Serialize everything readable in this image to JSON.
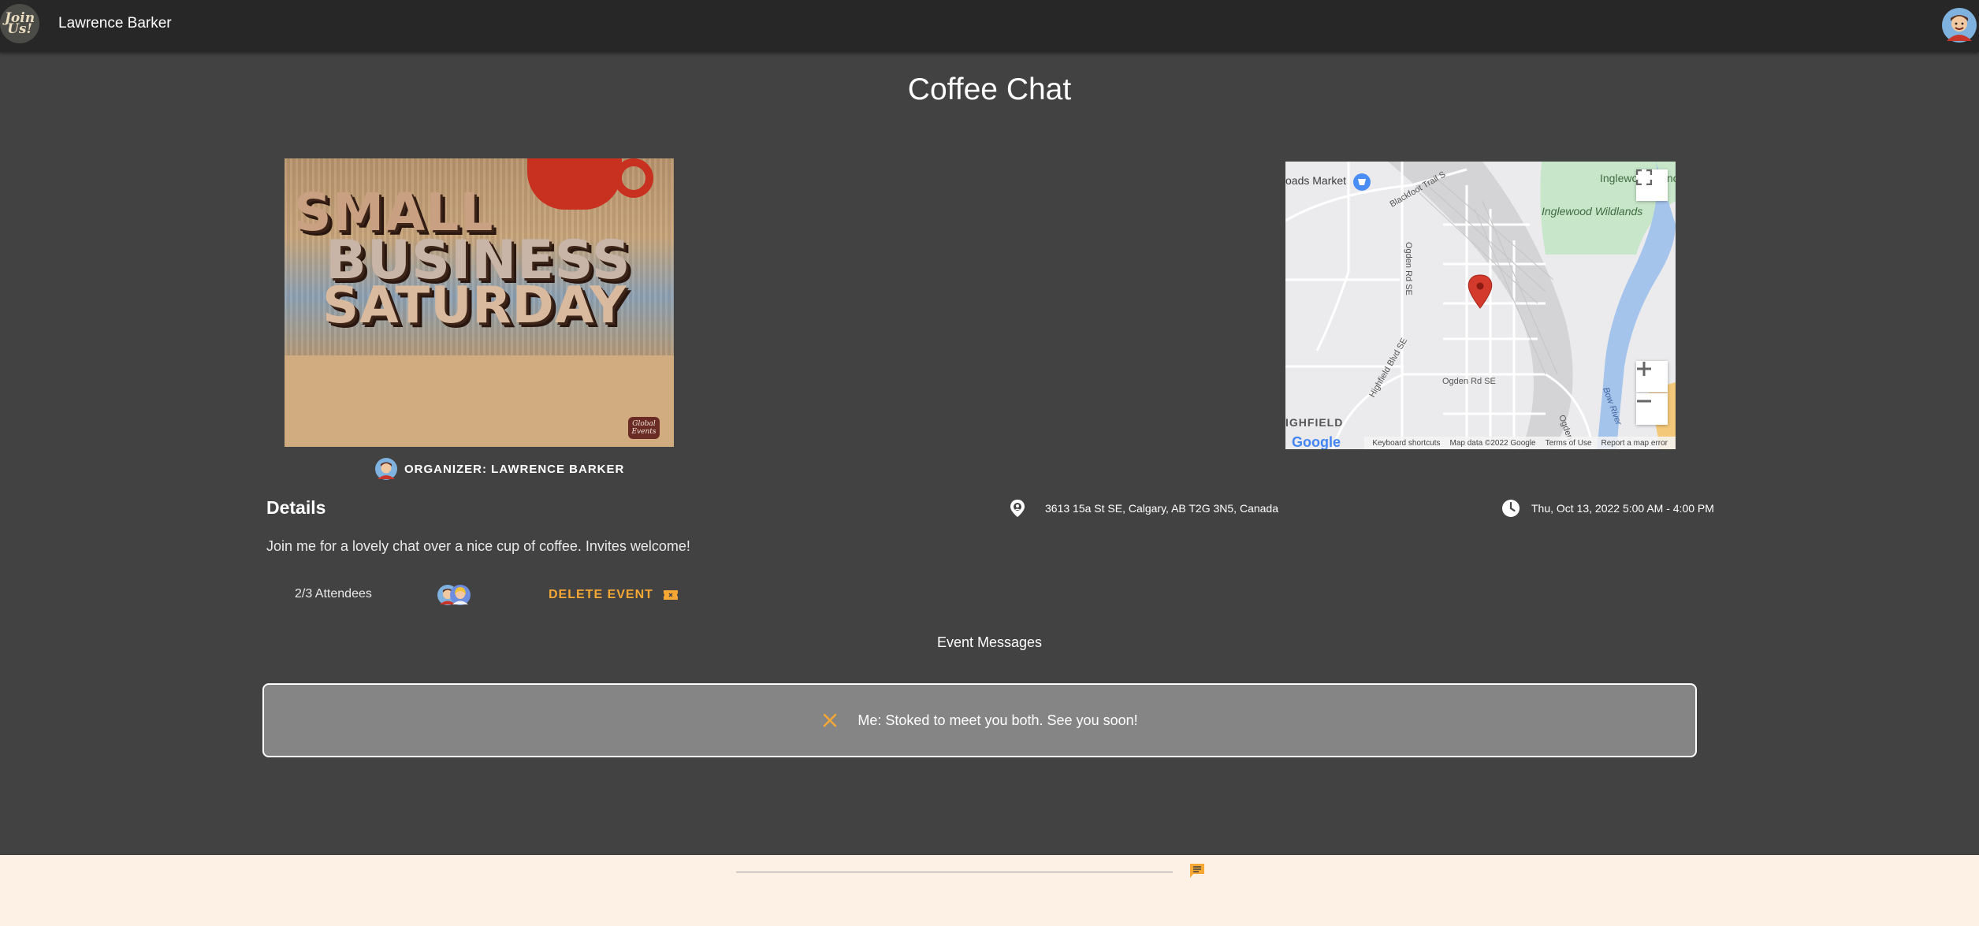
{
  "appbar": {
    "logo_text": "Join Us!",
    "title": "Lawrence Barker",
    "profile_icon": "user-avatar-icon"
  },
  "event": {
    "title": "Coffee Chat",
    "image": {
      "line1": "SMALL",
      "line2": "BUSINESS",
      "line3": "SATURDAY",
      "stamp": "Global Events"
    },
    "organizer_label": "ORGANIZER: LAWRENCE BARKER",
    "details_heading": "Details",
    "description": "Join me for a lovely chat over a nice cup of coffee. Invites welcome!",
    "location": "3613 15a St SE, Calgary, AB T2G 3N5, Canada",
    "datetime": "Thu, Oct 13, 2022 5:00 AM - 4:00 PM",
    "attendees": "2/3 Attendees",
    "delete_label": "DELETE EVENT"
  },
  "map": {
    "labels": {
      "market": "oads Market",
      "sanctuary": "Inglewood Sanctuary &",
      "wildlands": "Inglewood Wildlands",
      "blackfoot": "Blackfoot Trail S",
      "ogden_vertical": "Ogden Rd SE",
      "highfield_blvd": "Highfield Blvd SE",
      "ogden_horizontal": "Ogden Rd SE",
      "highfield": "IGHFIELD",
      "ogden_corner": "Ogden",
      "bow_river": "Bow River"
    },
    "footer": {
      "google": "Google",
      "shortcuts": "Keyboard shortcuts",
      "data": "Map data ©2022 Google",
      "terms": "Terms of Use",
      "report": "Report a map error"
    }
  },
  "messages": {
    "heading": "Event Messages",
    "items": [
      {
        "text": "Me: Stoked to meet you both. See you soon!"
      }
    ],
    "input_placeholder": ""
  },
  "colors": {
    "appbar": "#272727",
    "background": "#424242",
    "accent": "#f7a834",
    "footer": "#fcf1e4",
    "message_card": "#858585"
  },
  "icons": {
    "location": "location-pin-icon",
    "clock": "clock-icon",
    "ticket": "ticket-icon",
    "close": "close-icon",
    "send": "chat-send-icon"
  }
}
